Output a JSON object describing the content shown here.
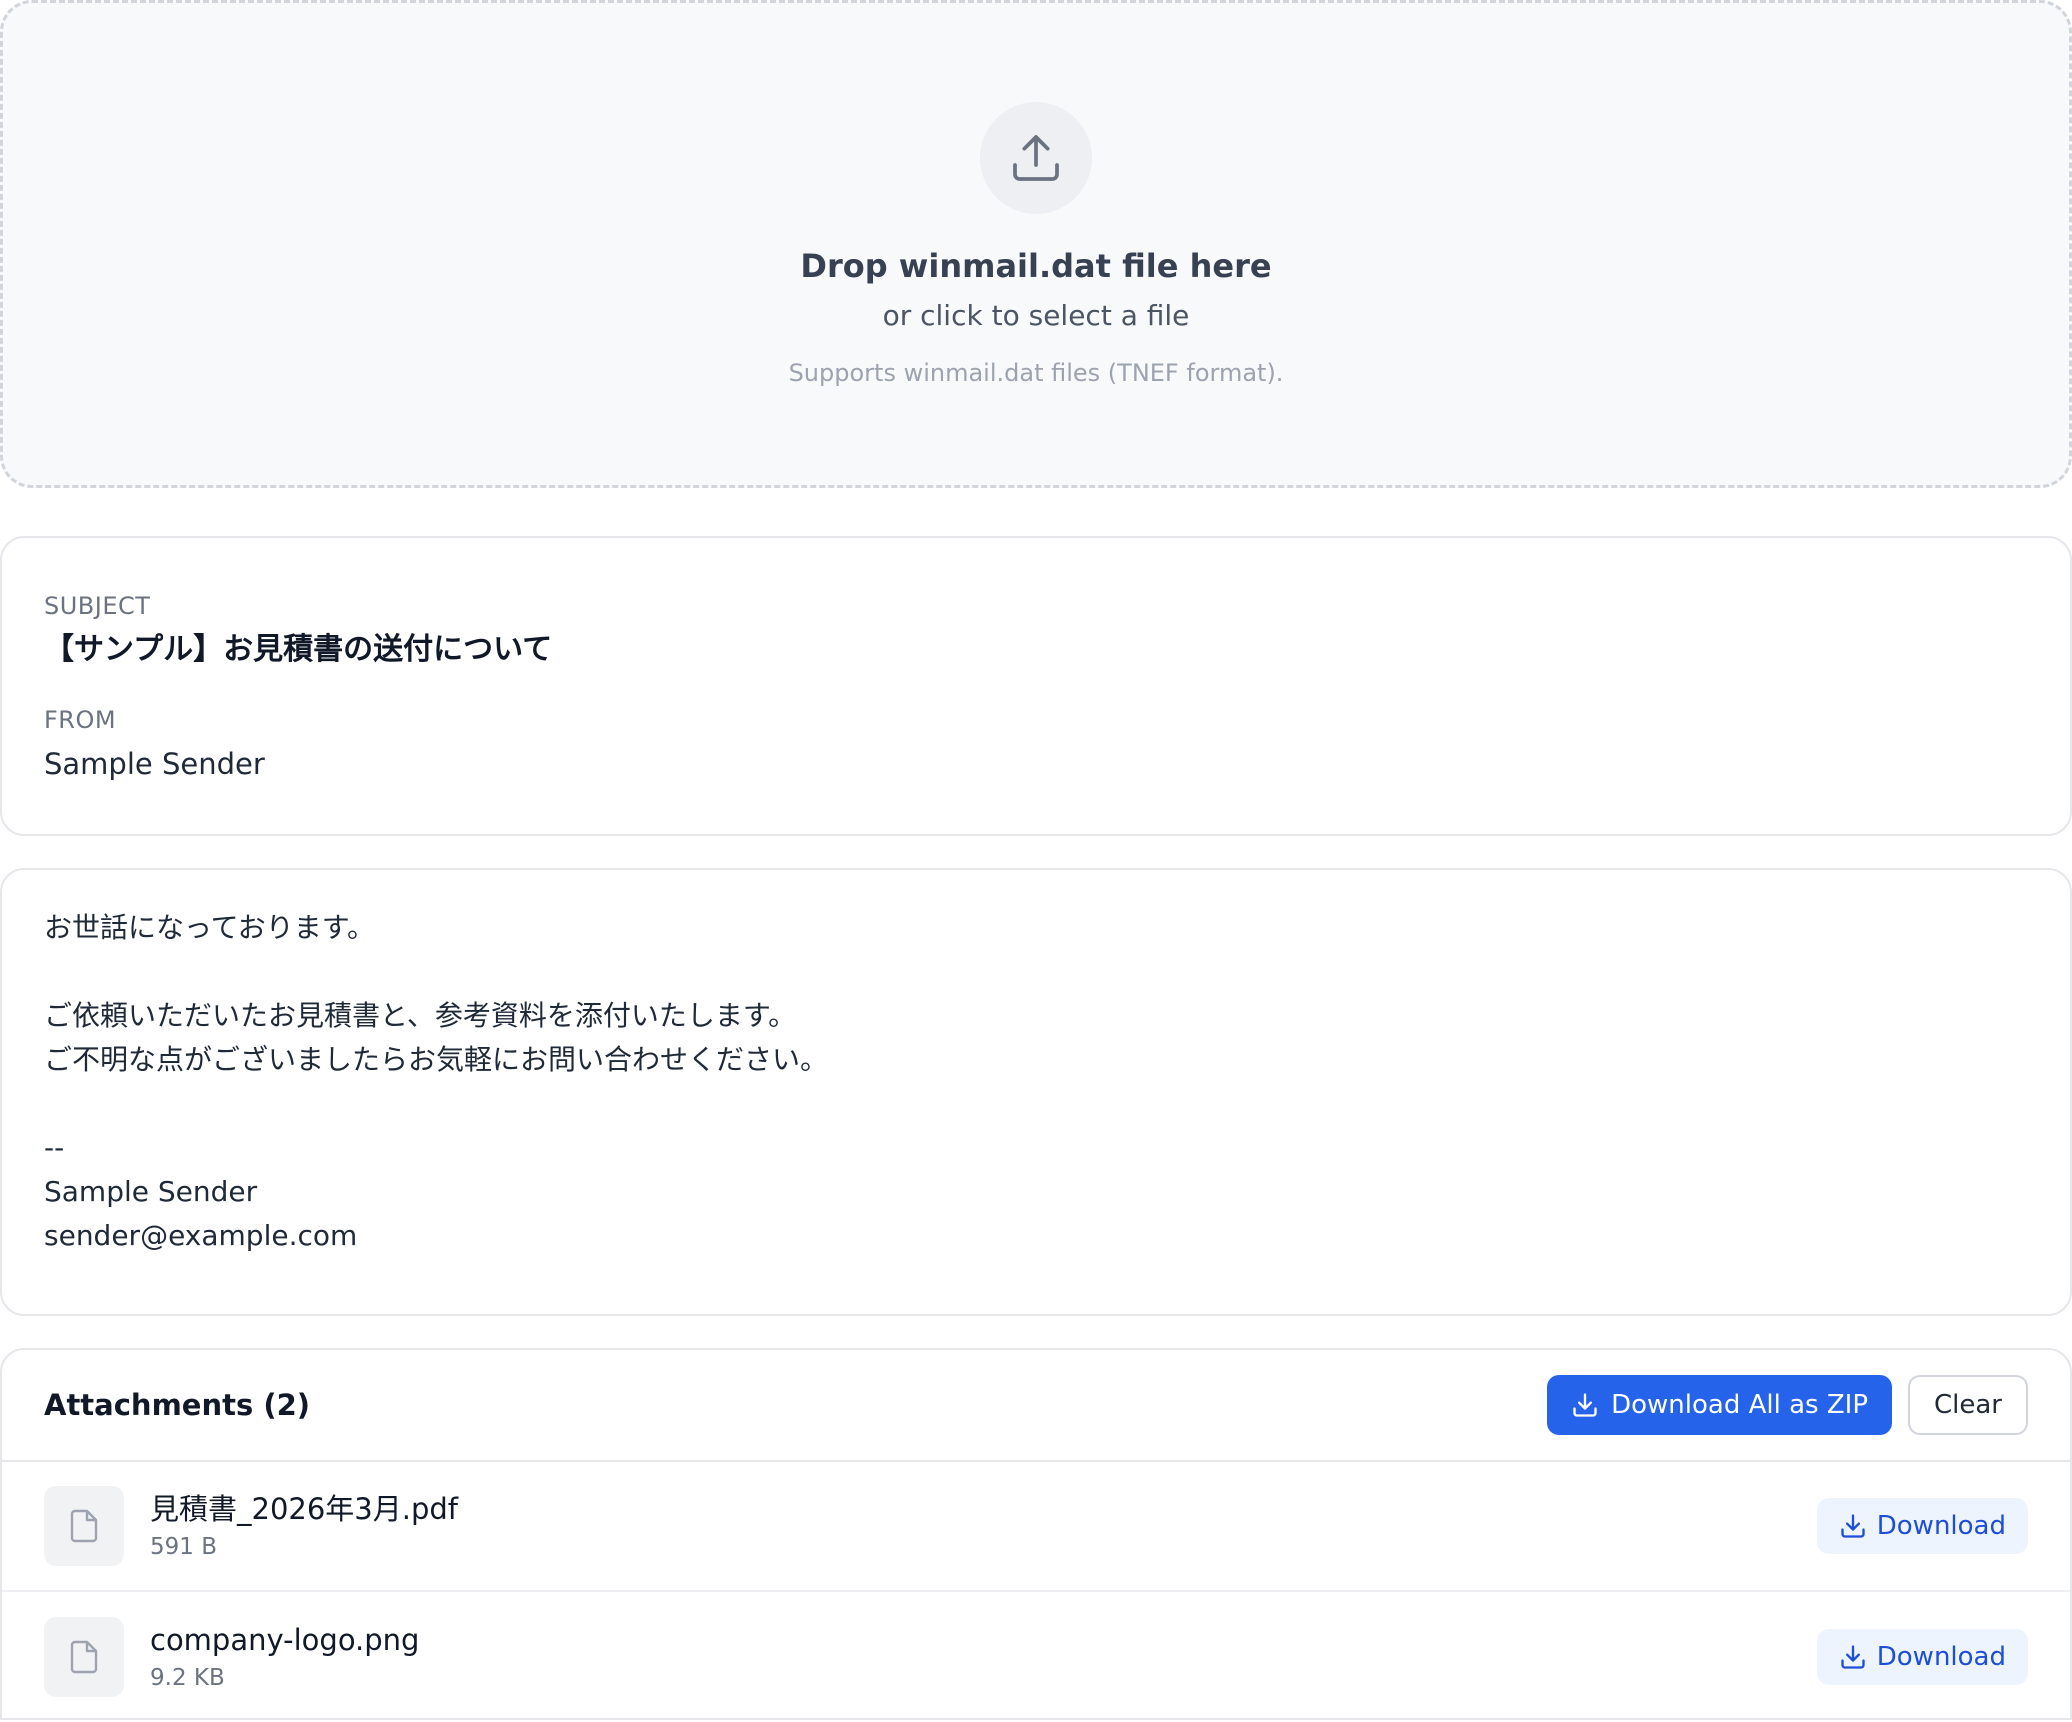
{
  "dropzone": {
    "icon": "upload-icon",
    "title": "Drop winmail.dat file here",
    "subtitle": "or click to select a file",
    "note": "Supports winmail.dat files (TNEF format)."
  },
  "message": {
    "subject_label": "SUBJECT",
    "subject": "【サンプル】お見積書の送付について",
    "from_label": "FROM",
    "from": "Sample Sender",
    "body_lines": [
      "お世話になっております。",
      "",
      "ご依頼いただいたお見積書と、参考資料を添付いたします。",
      "ご不明な点がございましたらお気軽にお問い合わせください。",
      "",
      "--",
      "Sample Sender",
      "sender@example.com"
    ]
  },
  "attachments": {
    "title": "Attachments (2)",
    "download_all_label": "Download All as ZIP",
    "clear_label": "Clear",
    "items": [
      {
        "name": "見積書_2026年3月.pdf",
        "size": "591 B",
        "icon": "file-icon",
        "download_label": "Download"
      },
      {
        "name": "company-logo.png",
        "size": "9.2 KB",
        "icon": "file-icon",
        "download_label": "Download"
      }
    ]
  },
  "colors": {
    "accent": "#2563eb",
    "download_button_bg": "#eef4fd",
    "download_button_text": "#1d4ed8"
  }
}
